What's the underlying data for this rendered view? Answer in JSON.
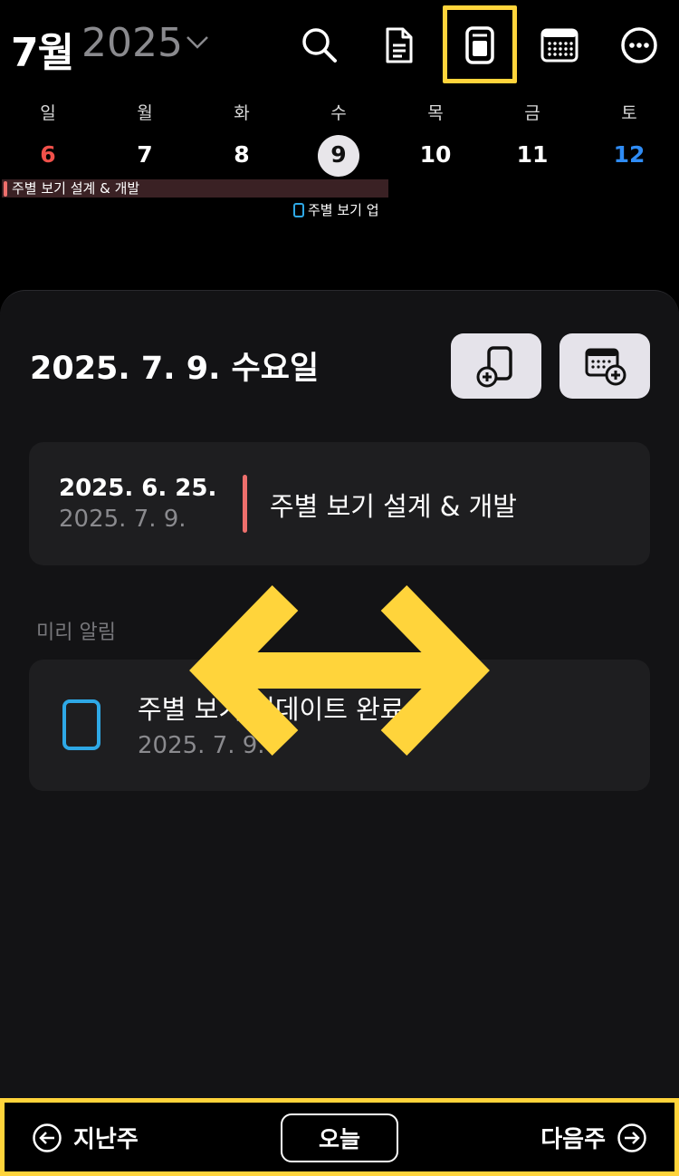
{
  "header": {
    "month": "7월",
    "year": "2025",
    "icons": [
      "search-icon",
      "document-icon",
      "week-view-icon",
      "month-calendar-icon",
      "more-icon"
    ]
  },
  "week": {
    "weekdays": [
      "일",
      "월",
      "화",
      "수",
      "목",
      "금",
      "토"
    ],
    "dates": [
      "6",
      "7",
      "8",
      "9",
      "10",
      "11",
      "12"
    ],
    "today_index": 3,
    "event_bar": "주별 보기 설계 & 개발",
    "todo_mini": "주별 보기 업"
  },
  "sheet": {
    "date_title": "2025. 7. 9. 수요일",
    "event_card": {
      "start": "2025. 6. 25.",
      "end": "2025. 7. 9.",
      "title": "주별 보기 설계 & 개발"
    },
    "reminder_section": "미리 알림",
    "reminder_card": {
      "title": "주별 보기 업데이트 완료",
      "date": "2025. 7. 9."
    }
  },
  "bottom": {
    "prev_label": "지난주",
    "today_label": "오늘",
    "next_label": "다음주"
  },
  "colors": {
    "highlight": "#FFD43B",
    "event": "#ee6f6c",
    "todo": "#2ea8e6",
    "sunday": "#f0504a",
    "saturday": "#2f8cf5"
  }
}
